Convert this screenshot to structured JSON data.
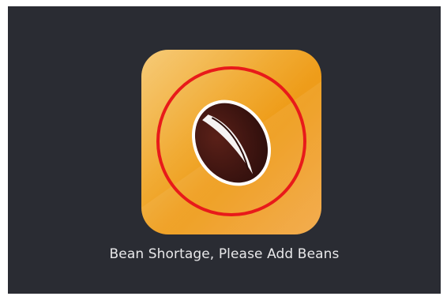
{
  "alert": {
    "message": "Bean Shortage, Please Add Beans",
    "icon": "coffee-bean-icon"
  },
  "colors": {
    "background": "#2a2c33",
    "tile_orange": "#f0a628",
    "alert_ring": "#e81a1a",
    "bean_dark": "#3a1512",
    "text": "#e8e8ea"
  }
}
